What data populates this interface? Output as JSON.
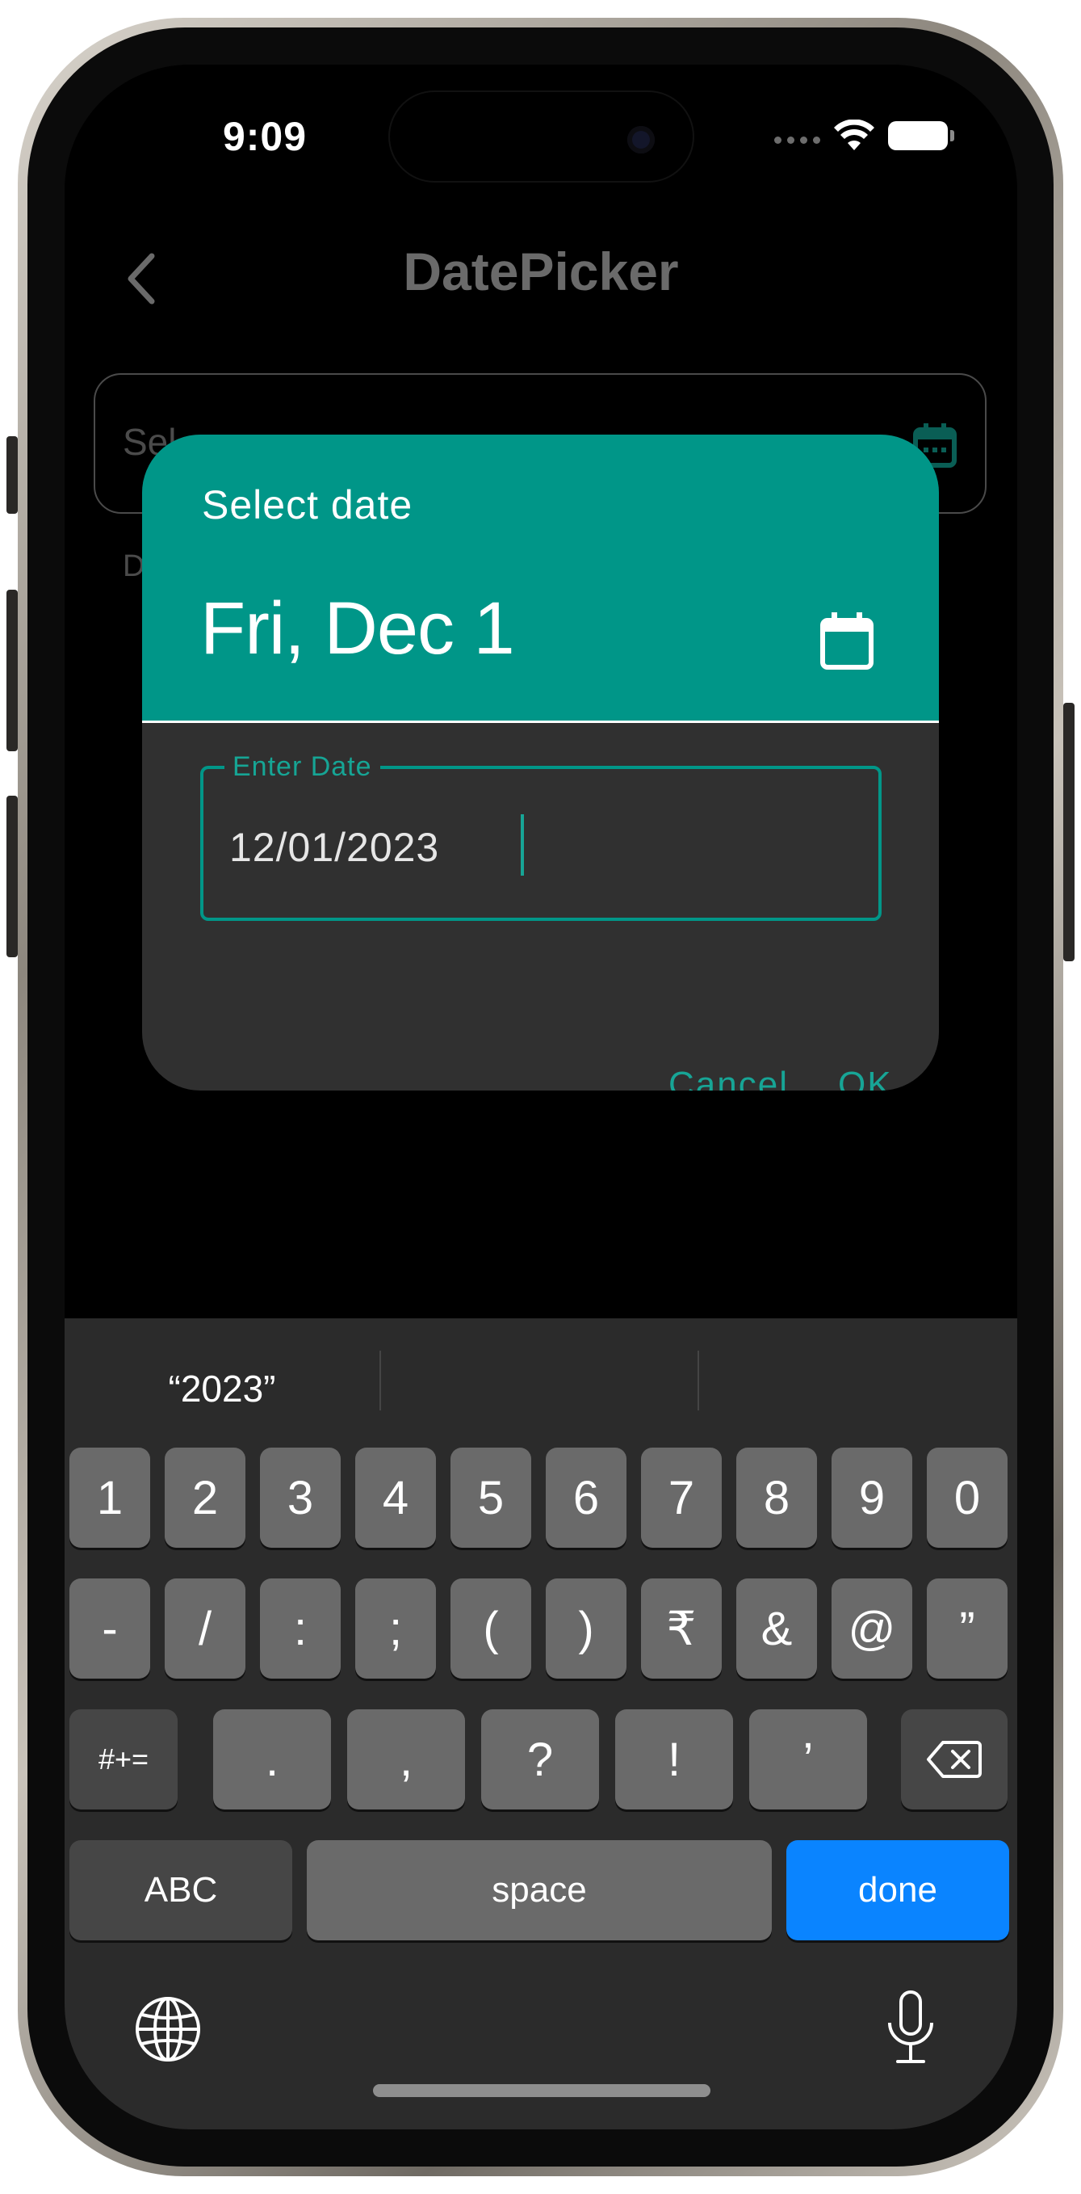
{
  "status_bar": {
    "time": "9:09"
  },
  "app_bar": {
    "title": "DatePicker"
  },
  "background_field": {
    "placeholder_fragment": "Sel",
    "helper_fragment": "D"
  },
  "dialog": {
    "subtitle": "Select date",
    "selected_date": "Fri, Dec 1",
    "input_label": "Enter Date",
    "input_value": "12/01/2023",
    "cancel_label": "Cancel",
    "ok_label": "OK",
    "accent_color": "#009688"
  },
  "keyboard": {
    "suggestions": [
      "“2023”",
      "",
      ""
    ],
    "row1": [
      "1",
      "2",
      "3",
      "4",
      "5",
      "6",
      "7",
      "8",
      "9",
      "0"
    ],
    "row2": [
      "-",
      "/",
      ":",
      ";",
      "(",
      ")",
      "₹",
      "&",
      "@",
      "”"
    ],
    "row3": [
      "#+=",
      ".",
      ",",
      "?",
      "!",
      "’"
    ],
    "abc_label": "ABC",
    "space_label": "space",
    "done_label": "done",
    "done_color": "#0a84ff"
  }
}
